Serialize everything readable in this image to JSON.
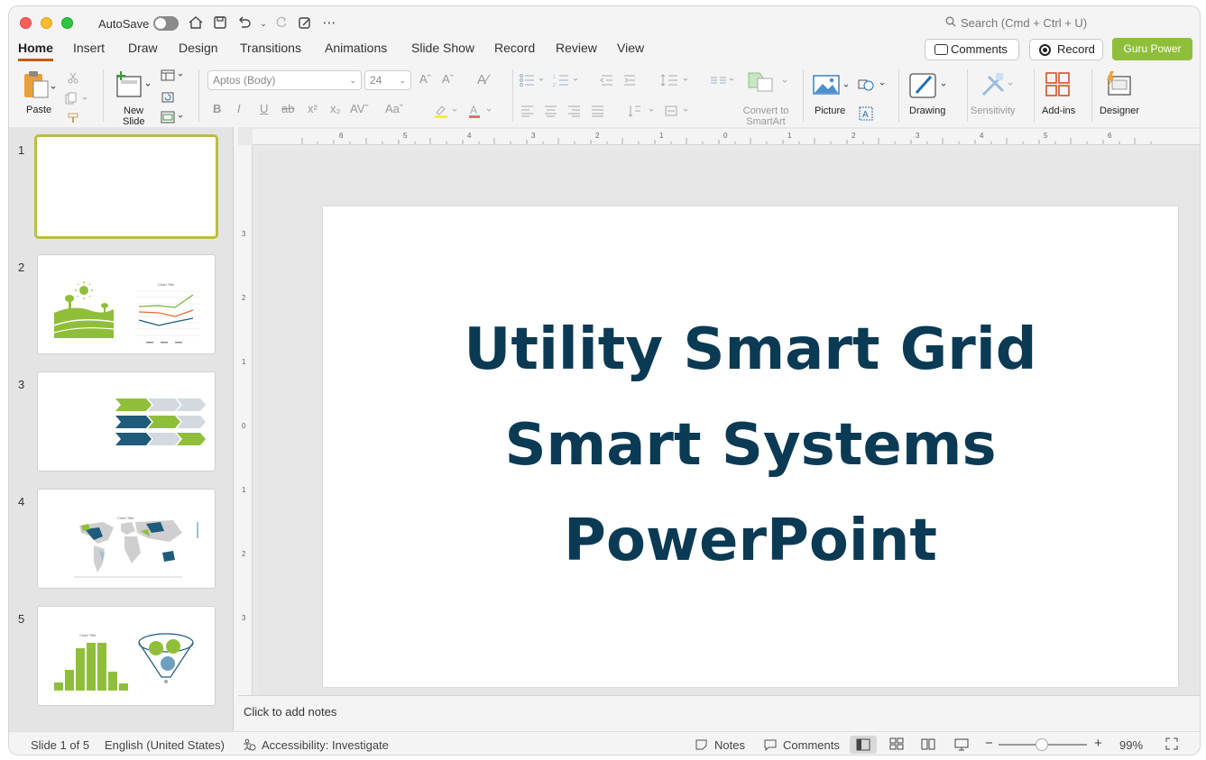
{
  "titlebar": {
    "autosave_label": "AutoSave",
    "search_placeholder": "Search (Cmd + Ctrl + U)"
  },
  "tabs": [
    {
      "label": "Home",
      "active": true
    },
    {
      "label": "Insert"
    },
    {
      "label": "Draw"
    },
    {
      "label": "Design"
    },
    {
      "label": "Transitions"
    },
    {
      "label": "Animations"
    },
    {
      "label": "Slide Show"
    },
    {
      "label": "Record"
    },
    {
      "label": "Review"
    },
    {
      "label": "View"
    }
  ],
  "top_buttons": {
    "comments": "Comments",
    "record": "Record",
    "guru": "Guru Power"
  },
  "ribbon": {
    "paste": "Paste",
    "new_slide_1": "New",
    "new_slide_2": "Slide",
    "font_name": "Aptos (Body)",
    "font_size": "24",
    "smartart_1": "Convert to",
    "smartart_2": "SmartArt",
    "picture": "Picture",
    "drawing": "Drawing",
    "sensitivity": "Sensitivity",
    "addins": "Add-ins",
    "designer": "Designer"
  },
  "thumbnails": [
    {
      "number": "1"
    },
    {
      "number": "2",
      "chart_title": "Chart Title"
    },
    {
      "number": "3"
    },
    {
      "number": "4",
      "chart_title": "Chart Title"
    },
    {
      "number": "5",
      "chart_title": "Chart Title"
    }
  ],
  "slide": {
    "title_line1": "Utility Smart Grid",
    "title_line2": "Smart Systems",
    "title_line3": "PowerPoint",
    "title_color": "#0b3a55"
  },
  "rulers": {
    "horizontal": [
      "6",
      "5",
      "4",
      "3",
      "2",
      "1",
      "0",
      "1",
      "2",
      "3",
      "4",
      "5",
      "6"
    ],
    "vertical": [
      "3",
      "2",
      "1",
      "0",
      "1",
      "2",
      "3"
    ]
  },
  "notes": {
    "placeholder": "Click to add notes"
  },
  "statusbar": {
    "slide_info": "Slide 1 of 5",
    "language": "English (United States)",
    "accessibility": "Accessibility: Investigate",
    "notes": "Notes",
    "comments": "Comments",
    "zoom_minus": "−",
    "zoom_plus": "+",
    "zoom": "99%"
  },
  "colors": {
    "accent_green": "#8fbf3a",
    "dark_blue": "#1f5b7a",
    "tab_underline": "#c55a11",
    "selected_border": "#b8be44"
  }
}
